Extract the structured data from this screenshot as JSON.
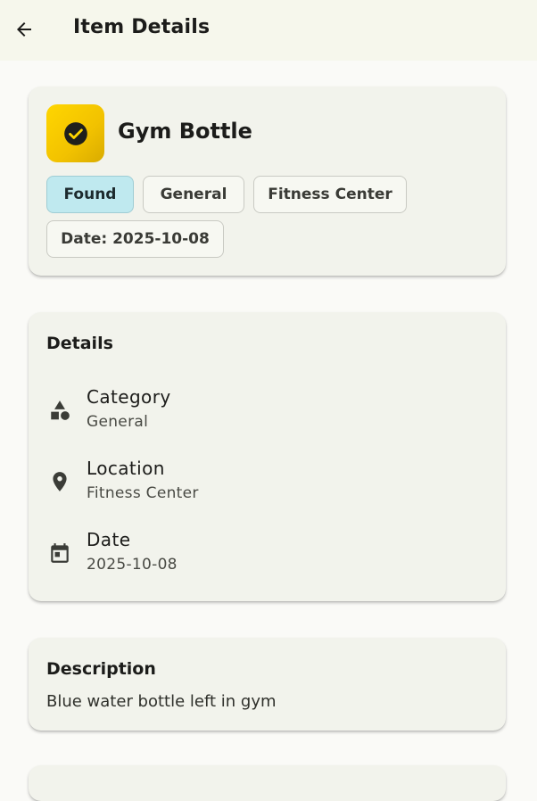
{
  "appbar": {
    "back_icon": "arrow-back-icon",
    "title": "Item Details"
  },
  "summary": {
    "status_icon": "check-circle-icon",
    "item_name": "Gym Bottle",
    "chips": {
      "status": "Found",
      "category": "General",
      "location": "Fitness Center",
      "date": "Date: 2025-10-08"
    },
    "colors": {
      "status_avatar": "#ffd600",
      "status_chip": "#bfe9ef"
    }
  },
  "details": {
    "title": "Details",
    "rows": [
      {
        "icon": "category-shapes-icon",
        "label": "Category",
        "value": "General"
      },
      {
        "icon": "location-pin-icon",
        "label": "Location",
        "value": "Fitness Center"
      },
      {
        "icon": "calendar-icon",
        "label": "Date",
        "value": "2025-10-08"
      }
    ]
  },
  "description": {
    "title": "Description",
    "text": "Blue water bottle left in gym"
  }
}
